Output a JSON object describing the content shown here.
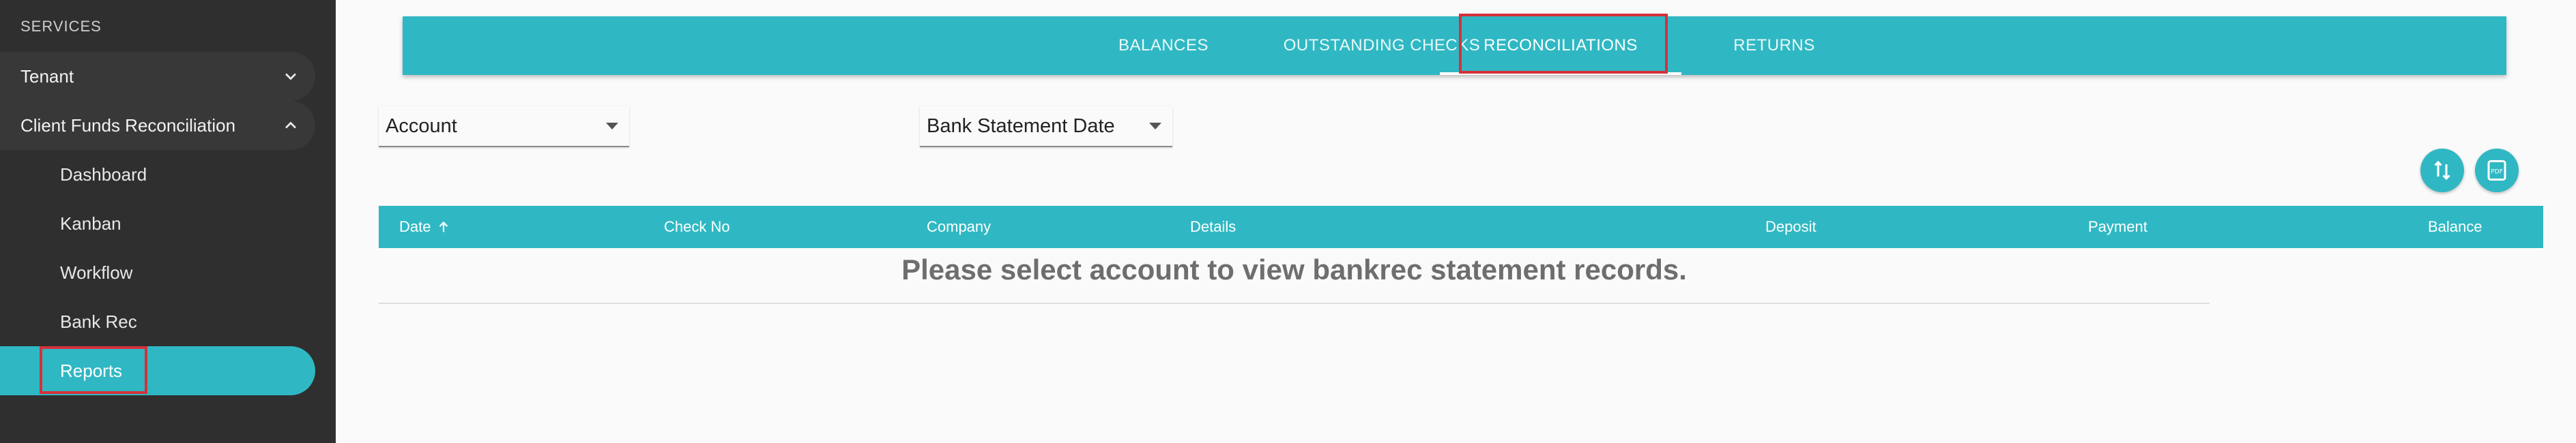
{
  "sidebar": {
    "section_title": "SERVICES",
    "groups": [
      {
        "label": "Tenant",
        "expanded": false
      },
      {
        "label": "Client Funds Reconciliation",
        "expanded": true
      }
    ],
    "items": [
      {
        "label": "Dashboard"
      },
      {
        "label": "Kanban"
      },
      {
        "label": "Workflow"
      },
      {
        "label": "Bank Rec"
      },
      {
        "label": "Reports",
        "active": true
      }
    ]
  },
  "tabs": [
    {
      "label": "BALANCES"
    },
    {
      "label": "OUTSTANDING CHECKS"
    },
    {
      "label": "RECONCILIATIONS",
      "active": true
    },
    {
      "label": "RETURNS"
    }
  ],
  "filters": {
    "account": "Account",
    "statement_date": "Bank Statement Date"
  },
  "actions": {
    "sort_icon": "swap-vertical-icon",
    "pdf_icon": "pdf-icon"
  },
  "table": {
    "columns": [
      "Date",
      "Check No",
      "Company",
      "Details",
      "Deposit",
      "Payment",
      "Balance"
    ],
    "sort_column": "Date",
    "sort_direction": "ascending",
    "empty_message": "Please select account to view bankrec statement records."
  },
  "colors": {
    "accent": "#2fb8c3",
    "sidebar_bg": "#2f2f2f",
    "highlight": "#d6303a"
  }
}
